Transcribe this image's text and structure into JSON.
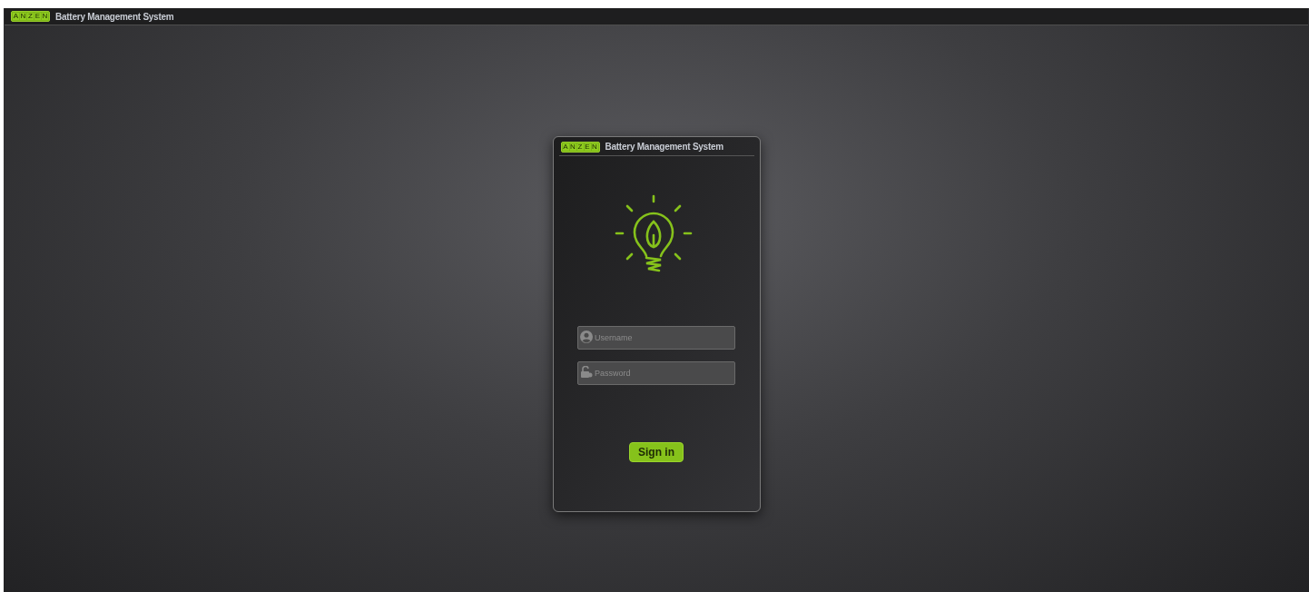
{
  "top_bar": {
    "logo_letters": [
      "A",
      "N",
      "Z",
      "E",
      "N"
    ],
    "title": "Battery Management System"
  },
  "login_card": {
    "logo_letters": [
      "A",
      "N",
      "Z",
      "E",
      "N"
    ],
    "title": "Battery Management System"
  },
  "fields": [
    {
      "kind": "user",
      "placeholder": "Username"
    },
    {
      "kind": "lock",
      "placeholder": "Password"
    }
  ],
  "button": "Sign in"
}
